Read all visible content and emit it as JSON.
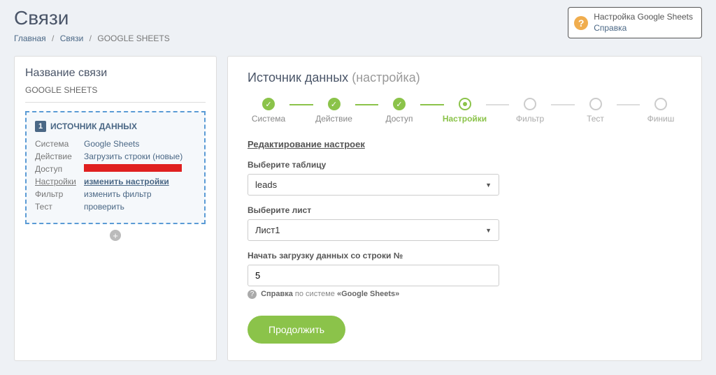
{
  "pageTitle": "Связи",
  "breadcrumb": {
    "home": "Главная",
    "links": "Связи",
    "current": "GOOGLE SHEETS"
  },
  "helpBox": {
    "title": "Настройка Google Sheets",
    "link": "Справка"
  },
  "leftPanel": {
    "title": "Название связи",
    "connName": "GOOGLE SHEETS",
    "sourceHeader": "ИСТОЧНИК ДАННЫХ",
    "sourceNum": "1",
    "rows": {
      "system": {
        "label": "Система",
        "value": "Google Sheets"
      },
      "action": {
        "label": "Действие",
        "value": "Загрузить строки (новые)"
      },
      "access": {
        "label": "Доступ"
      },
      "settings": {
        "label": "Настройки",
        "value": "изменить настройки"
      },
      "filter": {
        "label": "Фильтр",
        "value": "изменить фильтр"
      },
      "test": {
        "label": "Тест",
        "value": "проверить"
      }
    }
  },
  "rightPanel": {
    "title": "Источник данных",
    "subtitle": "(настройка)",
    "steps": [
      "Система",
      "Действие",
      "Доступ",
      "Настройки",
      "Фильтр",
      "Тест",
      "Финиш"
    ],
    "formTitle": "Редактирование настроек",
    "fields": {
      "table": {
        "label": "Выберите таблицу",
        "value": "leads"
      },
      "sheet": {
        "label": "Выберите лист",
        "value": "Лист1"
      },
      "startRow": {
        "label": "Начать загрузку данных со строки №",
        "value": "5"
      }
    },
    "helpText": {
      "prefix": "Справка",
      "middle": " по системе ",
      "system": "«Google Sheets»"
    },
    "continueBtn": "Продолжить"
  }
}
